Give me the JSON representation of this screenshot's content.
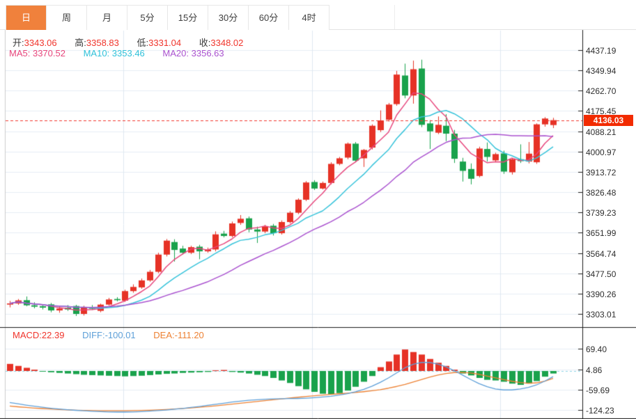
{
  "tabs": [
    {
      "label": "日",
      "active": true
    },
    {
      "label": "周",
      "active": false
    },
    {
      "label": "月",
      "active": false
    },
    {
      "label": "5分",
      "active": false
    },
    {
      "label": "15分",
      "active": false
    },
    {
      "label": "30分",
      "active": false
    },
    {
      "label": "60分",
      "active": false
    },
    {
      "label": "4时",
      "active": false
    }
  ],
  "info": {
    "ohlc": [
      {
        "label": "开:",
        "value": "3343.06"
      },
      {
        "label": "高:",
        "value": "3358.83"
      },
      {
        "label": "低:",
        "value": "3331.04"
      },
      {
        "label": "收:",
        "value": "3348.02"
      }
    ],
    "ma": [
      {
        "label": "MA5:",
        "value": "3370.52"
      },
      {
        "label": "MA10:",
        "value": "3353.46"
      },
      {
        "label": "MA20:",
        "value": "3356.63"
      }
    ]
  },
  "macd_info": [
    {
      "label": "MACD:",
      "value": "22.39"
    },
    {
      "label": "DIFF:",
      "value": "-100.01"
    },
    {
      "label": "DEA:",
      "value": "-111.20"
    }
  ],
  "price_tag": "4136.03",
  "colors": {
    "tab_active_bg": "#f0813c",
    "up": "#e63226",
    "down": "#19a24c",
    "ma5": "#e7467c",
    "ma10": "#36c3da",
    "ma20": "#aa52cf",
    "diff_line": "#5d9fd8",
    "dea_line": "#ed8133",
    "grid": "#e6edf4",
    "grid_v": "#dfe8f0",
    "frame": "#1a1a1a",
    "left_border": "#cccccc",
    "price_dash": "#f0342b",
    "zero_dash": "#8bd4e6",
    "tag_bg": "#f22b00",
    "value_red": "#f0342b"
  },
  "chart_data": {
    "type": "candlestick",
    "title": "",
    "legend": [
      "MA5",
      "MA10",
      "MA20",
      "MACD",
      "DIFF",
      "DEA"
    ],
    "y_axis_labels": [
      "4437.19",
      "4349.94",
      "4262.70",
      "4175.45",
      "4088.21",
      "4000.97",
      "3913.72",
      "3826.48",
      "3739.23",
      "3651.99",
      "3564.74",
      "3477.50",
      "3390.26",
      "3303.01"
    ],
    "macd_axis_labels": [
      "69.40",
      "4.86",
      "-59.69",
      "-124.23"
    ],
    "y_range": [
      3303.01,
      4437.19
    ],
    "macd_range": [
      -124.23,
      69.4
    ],
    "current_price": 4136.03,
    "grid_x": [
      177,
      448,
      718
    ],
    "ma_windows": [
      5,
      10,
      20
    ],
    "candles": [
      [
        3343.06,
        3358.83,
        3331.04,
        3348.02
      ],
      [
        3348,
        3367,
        3342,
        3361
      ],
      [
        3362,
        3378,
        3336,
        3340
      ],
      [
        3340,
        3353,
        3327,
        3334
      ],
      [
        3336,
        3345,
        3322,
        3330
      ],
      [
        3344,
        3350,
        3310,
        3318
      ],
      [
        3318,
        3335,
        3308,
        3326
      ],
      [
        3330,
        3341,
        3316,
        3322
      ],
      [
        3337,
        3342,
        3294,
        3303
      ],
      [
        3303,
        3338,
        3296,
        3333
      ],
      [
        3333,
        3341,
        3320,
        3325
      ],
      [
        3316,
        3347,
        3310,
        3343
      ],
      [
        3343,
        3372,
        3339,
        3365
      ],
      [
        3367,
        3375,
        3357,
        3362
      ],
      [
        3360,
        3407,
        3355,
        3401
      ],
      [
        3401,
        3430,
        3394,
        3419
      ],
      [
        3417,
        3455,
        3411,
        3447
      ],
      [
        3447,
        3492,
        3441,
        3484
      ],
      [
        3484,
        3566,
        3478,
        3558
      ],
      [
        3558,
        3625,
        3550,
        3618
      ],
      [
        3612,
        3624,
        3528,
        3578
      ],
      [
        3584,
        3596,
        3558,
        3566
      ],
      [
        3566,
        3596,
        3560,
        3590
      ],
      [
        3592,
        3600,
        3538,
        3572
      ],
      [
        3572,
        3588,
        3566,
        3580
      ],
      [
        3580,
        3658,
        3572,
        3645
      ],
      [
        3648,
        3660,
        3632,
        3638
      ],
      [
        3638,
        3700,
        3632,
        3692
      ],
      [
        3694,
        3728,
        3686,
        3712
      ],
      [
        3714,
        3722,
        3654,
        3666
      ],
      [
        3666,
        3678,
        3608,
        3657
      ],
      [
        3657,
        3686,
        3650,
        3679
      ],
      [
        3682,
        3690,
        3640,
        3650
      ],
      [
        3650,
        3705,
        3644,
        3698
      ],
      [
        3698,
        3745,
        3692,
        3738
      ],
      [
        3738,
        3800,
        3732,
        3794
      ],
      [
        3794,
        3874,
        3788,
        3868
      ],
      [
        3870,
        3878,
        3836,
        3842
      ],
      [
        3842,
        3872,
        3838,
        3866
      ],
      [
        3866,
        3955,
        3860,
        3948
      ],
      [
        3948,
        3978,
        3942,
        3972
      ],
      [
        3975,
        4040,
        3968,
        4035
      ],
      [
        4035,
        4042,
        3955,
        3962
      ],
      [
        3972,
        4012,
        3935,
        4008
      ],
      [
        4018,
        4118,
        4010,
        4112
      ],
      [
        4093,
        4178,
        4085,
        4135
      ],
      [
        4138,
        4210,
        4130,
        4203
      ],
      [
        4205,
        4348,
        4198,
        4332
      ],
      [
        4328,
        4379,
        4230,
        4242
      ],
      [
        4242,
        4392,
        4207,
        4355
      ],
      [
        4358,
        4396,
        4106,
        4116
      ],
      [
        4122,
        4136,
        4012,
        4088
      ],
      [
        4082,
        4152,
        4076,
        4116
      ],
      [
        4112,
        4162,
        4046,
        4078
      ],
      [
        4078,
        4094,
        3952,
        3970
      ],
      [
        3958,
        3974,
        3872,
        3918
      ],
      [
        3926,
        3950,
        3860,
        3884
      ],
      [
        3896,
        4022,
        3890,
        4014
      ],
      [
        4012,
        4040,
        3958,
        3978
      ],
      [
        3963,
        3996,
        3955,
        3990
      ],
      [
        3993,
        4005,
        3905,
        3915
      ],
      [
        3912,
        3972,
        3902,
        3968
      ],
      [
        3968,
        4032,
        3952,
        3960
      ],
      [
        3958,
        4042,
        3950,
        3992
      ],
      [
        3955,
        4122,
        3948,
        4118
      ],
      [
        4118,
        4149,
        4108,
        4143
      ],
      [
        4115,
        4146,
        4102,
        4136.03
      ]
    ],
    "macd": {
      "hist": [
        22.39,
        16,
        10,
        4,
        -2,
        -4,
        -6,
        -8,
        -10,
        -12,
        -13,
        -14,
        -15,
        -16,
        -17,
        -16,
        -15,
        -13,
        -11,
        -9,
        -8,
        -6,
        -5,
        -4,
        -3,
        2,
        3,
        -3,
        -5,
        -8,
        -12,
        -16,
        -22,
        -30,
        -38,
        -48,
        -58,
        -66,
        -72,
        -74,
        -70,
        -62,
        -50,
        -34,
        -16,
        12,
        30,
        52,
        68,
        60,
        52,
        38,
        26,
        16,
        4,
        -8,
        -14,
        -22,
        -28,
        -30,
        -34,
        -40,
        -44,
        -40,
        -32,
        -18,
        -8
      ],
      "diff": [
        -100.01,
        -104,
        -108,
        -111.5,
        -115,
        -118,
        -120.5,
        -122.5,
        -124.5,
        -126,
        -127.5,
        -128.5,
        -129.5,
        -130,
        -130,
        -129.5,
        -128.5,
        -127,
        -125.5,
        -123.5,
        -121,
        -118.5,
        -115.5,
        -112.5,
        -109,
        -105.5,
        -102,
        -98.5,
        -95.5,
        -93,
        -91,
        -89.5,
        -88.5,
        -88,
        -87.5,
        -87,
        -86,
        -84.5,
        -82.5,
        -80,
        -76.5,
        -72,
        -66,
        -58,
        -48,
        -36,
        -22,
        -6,
        10,
        21,
        27,
        27,
        22,
        13,
        1,
        -13,
        -27,
        -40,
        -50,
        -57,
        -60,
        -60,
        -57,
        -52,
        -44,
        -32,
        -18
      ],
      "dea": [
        -111.2,
        -113.5,
        -115.5,
        -117.5,
        -119,
        -120.5,
        -121.8,
        -123,
        -124,
        -124.8,
        -125.4,
        -125.8,
        -126,
        -126,
        -125.8,
        -125.4,
        -124.8,
        -124,
        -123,
        -121.8,
        -120.4,
        -118.8,
        -117,
        -115,
        -112.8,
        -110.4,
        -107.8,
        -105,
        -102.2,
        -99.4,
        -96.6,
        -93.8,
        -91,
        -88.3,
        -85.7,
        -83.2,
        -80.8,
        -78.5,
        -76.3,
        -74.2,
        -72.2,
        -70.2,
        -68,
        -65.5,
        -62.5,
        -59,
        -54.5,
        -49,
        -42.5,
        -35,
        -27,
        -19.5,
        -13,
        -8,
        -5,
        -4.5,
        -6.5,
        -10.5,
        -16,
        -22,
        -27.5,
        -32.5,
        -36.5,
        -39,
        -37.5,
        -32,
        -23.5
      ]
    }
  }
}
